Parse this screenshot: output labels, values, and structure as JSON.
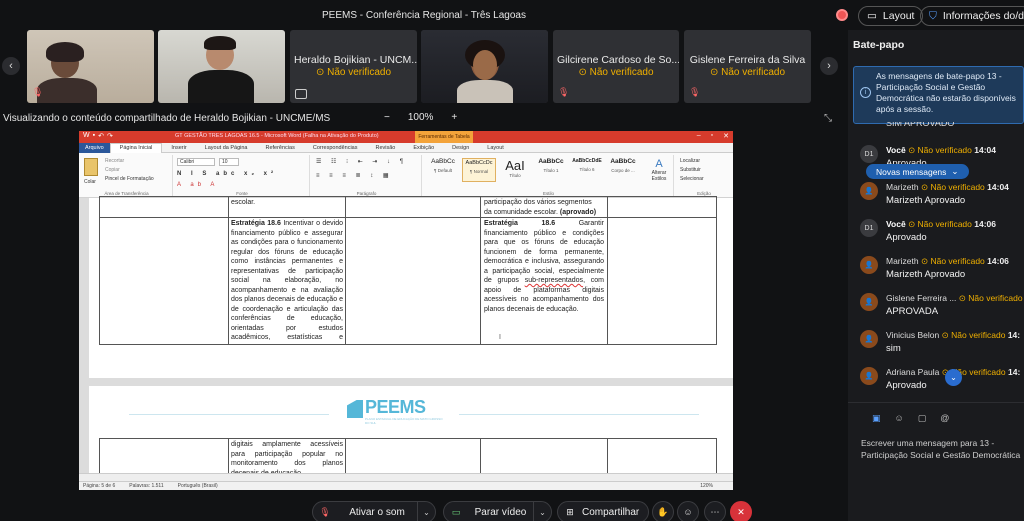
{
  "window": {
    "title": "PEEMS - Conferência Regional - Três Lagoas"
  },
  "header": {
    "layout_label": "Layout",
    "info_label": "Informações do/da"
  },
  "participants": [
    {
      "name": "",
      "status": "",
      "mic_muted": true,
      "video": true
    },
    {
      "name": "",
      "status": "",
      "mic_muted": false,
      "video": true
    },
    {
      "name": "Heraldo Bojikian - UNCM...",
      "status": "Não verificado",
      "mic_muted": false,
      "video": false
    },
    {
      "name": "",
      "status": "",
      "mic_muted": false,
      "video": true
    },
    {
      "name": "Gilcirene Cardoso de So...",
      "status": "Não verificado",
      "mic_muted": true,
      "video": false
    },
    {
      "name": "Gislene Ferreira da Silva",
      "status": "Não verificado",
      "mic_muted": true,
      "video": false
    }
  ],
  "share": {
    "label": "Visualizando o conteúdo compartilhado de Heraldo Bojikian - UNCME/MS",
    "zoom_out": "−",
    "zoom_level": "100%",
    "zoom_in": "+"
  },
  "word": {
    "title": "GT GESTÃO TRES LAGOAS 16.5 - Microsoft Word (Falha na Ativação do Produto)",
    "contextual_tab": "Ferramentas de Tabela",
    "tabs": [
      "Arquivo",
      "Página Inicial",
      "Inserir",
      "Layout da Página",
      "Referências",
      "Correspondências",
      "Revisão",
      "Exibição",
      "Design",
      "Layout"
    ],
    "ribbon": {
      "paste": "Colar",
      "cut": "Recortar",
      "copy": "Copiar",
      "format_painter": "Pincel de Formatação",
      "clipboard_group": "Área de Transferência",
      "font_name": "Calibri",
      "font_size": "10",
      "font_group": "Fonte",
      "paragraph_group": "Parágrafo",
      "styles_group": "Estilo",
      "styles": [
        {
          "preview": "AaBbCc",
          "name": "¶ Default"
        },
        {
          "preview": "AaBbCcDc",
          "name": "¶ Normal"
        },
        {
          "preview": "AaI",
          "name": "Título"
        },
        {
          "preview": "AaBbCc",
          "name": "Título 1"
        },
        {
          "preview": "AaBbCcDdE",
          "name": "Título 6"
        },
        {
          "preview": "AaBbCc",
          "name": "Corpo de ..."
        }
      ],
      "change_styles": "Alterar Estilos",
      "find": "Localizar",
      "replace": "Substituir",
      "select": "Selecionar",
      "edit_group": "Edição"
    },
    "doc": {
      "row0_left": "escolar.",
      "row0_right_a": "participação dos vários segmentos",
      "row0_right_b": "da comunidade escolar.",
      "row0_right_approved": "(aprovado)",
      "left_heading": "Estratégia 18.6",
      "left_text": "Incentivar o devido financiamento público e assegurar as condições para o funcionamento regular dos fóruns de educação como instâncias permanentes e representativas de participação social na elaboração, no acompanhamento e na avaliação dos planos decenais de educação e de coordenação e articulação das conferências de educação, orientadas por estudos acadêmicos, estatísticas e indicadores oficiais, garantida a representatividade, e com plataformas",
      "right_heading": "Estratégia 18.6",
      "right_text_a": "Garantir financiamento público e condições para que os fóruns de educação funcionem de forma permanente, democrática e inclusiva, assegurando a participação social, especialmente de grupos",
      "right_underlined": "sub-representados",
      "right_text_b": ", com apoio de plataformas digitais acessíveis no acompanhamento dos planos decenais de educação.",
      "logo_text": "PEEMS",
      "logo_sub": "PLANO ESTADUAL DE EDUCAÇÃO DE MATO GROSSO DO SUL",
      "page2_text": "digitais amplamente acessíveis para participação popular no monitoramento dos planos decenais de educação."
    },
    "status": {
      "page": "Página: 5 de 6",
      "words": "Palavras: 1.511",
      "language": "Português (Brasil)",
      "zoom": "120%"
    }
  },
  "chat": {
    "title": "Bate-papo",
    "notice": "As mensagens de bate-papo 13 - Participação Social e Gestão Democrática não estarão disponíveis após a sessão.",
    "clipped_top": "SIM APROVADO",
    "messages": [
      {
        "avatar": "D1",
        "sender": "Você",
        "status": "Não verificado",
        "time": "14:04",
        "text": "Aprovado"
      },
      {
        "avatar": "",
        "sender": "Marizeth",
        "status": "Não verificado",
        "time": "14:04",
        "text": "Marizeth  Aprovado"
      },
      {
        "avatar": "D1",
        "sender": "Você",
        "status": "Não verificado",
        "time": "14:06",
        "text": "Aprovado"
      },
      {
        "avatar": "",
        "sender": "Marizeth",
        "status": "Não verificado",
        "time": "14:06",
        "text": "Marizeth  Aprovado"
      },
      {
        "avatar": "",
        "sender": "Gislene Ferreira ...",
        "status": "Não verificado",
        "time": "",
        "text": "APROVADA"
      },
      {
        "avatar": "",
        "sender": "Vinicius Belon",
        "status": "Não verificado",
        "time": "14:",
        "text": "sim"
      },
      {
        "avatar": "",
        "sender": "Adriana Paula",
        "status": "Não verificado",
        "time": "14:",
        "text": "Aprovado"
      }
    ],
    "new_messages": "Novas mensagens",
    "input_placeholder": "Escrever uma mensagem para 13 - Participação Social e Gestão Democrática"
  },
  "toolbar": {
    "mute_label": "Ativar o som",
    "video_label": "Parar vídeo",
    "share_label": "Compartilhar"
  },
  "colors": {
    "warning": "#f0b000",
    "accent": "#2a6ccf",
    "leave": "#d8323a",
    "word_title": "#d63b2c"
  }
}
